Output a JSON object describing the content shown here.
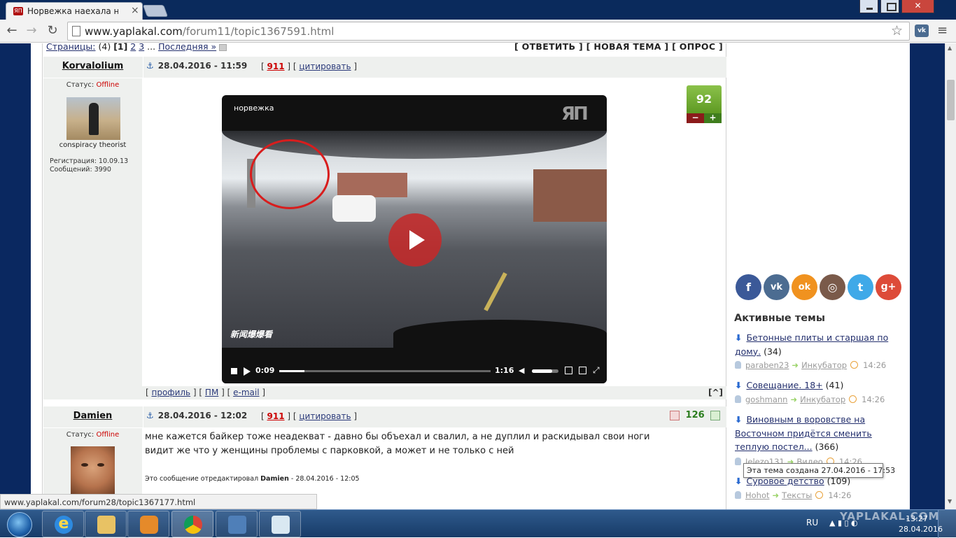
{
  "browser": {
    "tab_title": "Норвежка наехала на",
    "tab_close": "×",
    "url_host": "www.yaplakal.com",
    "url_path": "/forum11/topic1367591.html",
    "win_close": "✕",
    "vk_ext": "vk",
    "status_url": "www.yaplakal.com/forum28/topic1367177.html"
  },
  "pagination": {
    "label": "Страницы:",
    "count": "(4)",
    "current": "[1]",
    "p2": "2",
    "p3": "3",
    "ellipsis": "...",
    "last": "Последняя »"
  },
  "actions": {
    "reply": "[ ОТВЕТИТЬ ]",
    "new_topic": "[ НОВАЯ ТЕМА ]",
    "poll": "[ ОПРОС ]"
  },
  "post1": {
    "author": "Korvalolium",
    "datetime": "28.04.2016 - 11:59",
    "num": "911",
    "quote": "цитировать",
    "status_label": "Статус:",
    "status_value": "Offline",
    "user_title": "conspiracy theorist",
    "registration": "Регистрация: 10.09.13",
    "messages": "Сообщений: 3990",
    "rating": "92",
    "rating_minus": "−",
    "rating_plus": "+",
    "video_title": "норвежка",
    "video_logo": "ЯП",
    "video_watermark": "新闻爆爆看",
    "video_time": "0:09",
    "video_duration": "1:16",
    "video_progress_fraction": 0.118,
    "video_volume_fraction": 0.75,
    "footer_profile": "профиль",
    "footer_pm": "ПМ",
    "footer_email": "e-mail",
    "to_top": "[^]"
  },
  "post2": {
    "author": "Damien",
    "datetime": "28.04.2016 - 12:02",
    "num": "911",
    "quote": "цитировать",
    "status_label": "Статус:",
    "status_value": "Offline",
    "rating": "126",
    "text_line1": "мне кажется байкер тоже неадекват - давно бы объехал и свалил, а не дуплил и раскидывал свои ноги",
    "text_line2": "видит же что у женщины проблемы с парковкой, а может и не только с ней",
    "edited_prefix": "Это сообщение отредактировал",
    "edited_by": "Damien",
    "edited_date": "- 28.04.2016 - 12:05"
  },
  "sidebar": {
    "socials": [
      {
        "icon": "facebook-icon",
        "glyph": "f",
        "color": "#3b5998"
      },
      {
        "icon": "vk-icon",
        "glyph": "vk",
        "color": "#4c6c91"
      },
      {
        "icon": "odnoklassniki-icon",
        "glyph": "ok",
        "color": "#f0921f"
      },
      {
        "icon": "instagram-icon",
        "glyph": "◎",
        "color": "#7a5a4a"
      },
      {
        "icon": "twitter-icon",
        "glyph": "t",
        "color": "#3fa9e8"
      },
      {
        "icon": "google-plus-icon",
        "glyph": "g+",
        "color": "#dd4b39"
      }
    ],
    "active_title": "Активные темы",
    "topics": [
      {
        "title": "Бетонные плиты и старшая по дому.",
        "count": "(34)",
        "user": "paraben23",
        "section": "Инкубатор",
        "time": "14:26"
      },
      {
        "title": "Совещание. 18+",
        "count": "(41)",
        "user": "goshmann",
        "section": "Инкубатор",
        "time": "14:26"
      },
      {
        "title": "Виновным в воровстве на Восточном придётся сменить теплую постел...",
        "count": "(366)",
        "user": "Jelezo131",
        "section": "Видео",
        "time": "14:26"
      },
      {
        "title": "Суровое детство",
        "count": "(109)",
        "user": "Hohot",
        "section": "Тексты",
        "time": "14:26"
      }
    ],
    "tooltip": "Эта тема создана 27.04.2016 - 17:53"
  },
  "taskbar": {
    "lang": "RU",
    "time": "13:27",
    "date": "28.04.2016",
    "watermark": "YAPLAKAL.COM",
    "ie_glyph": "e"
  }
}
